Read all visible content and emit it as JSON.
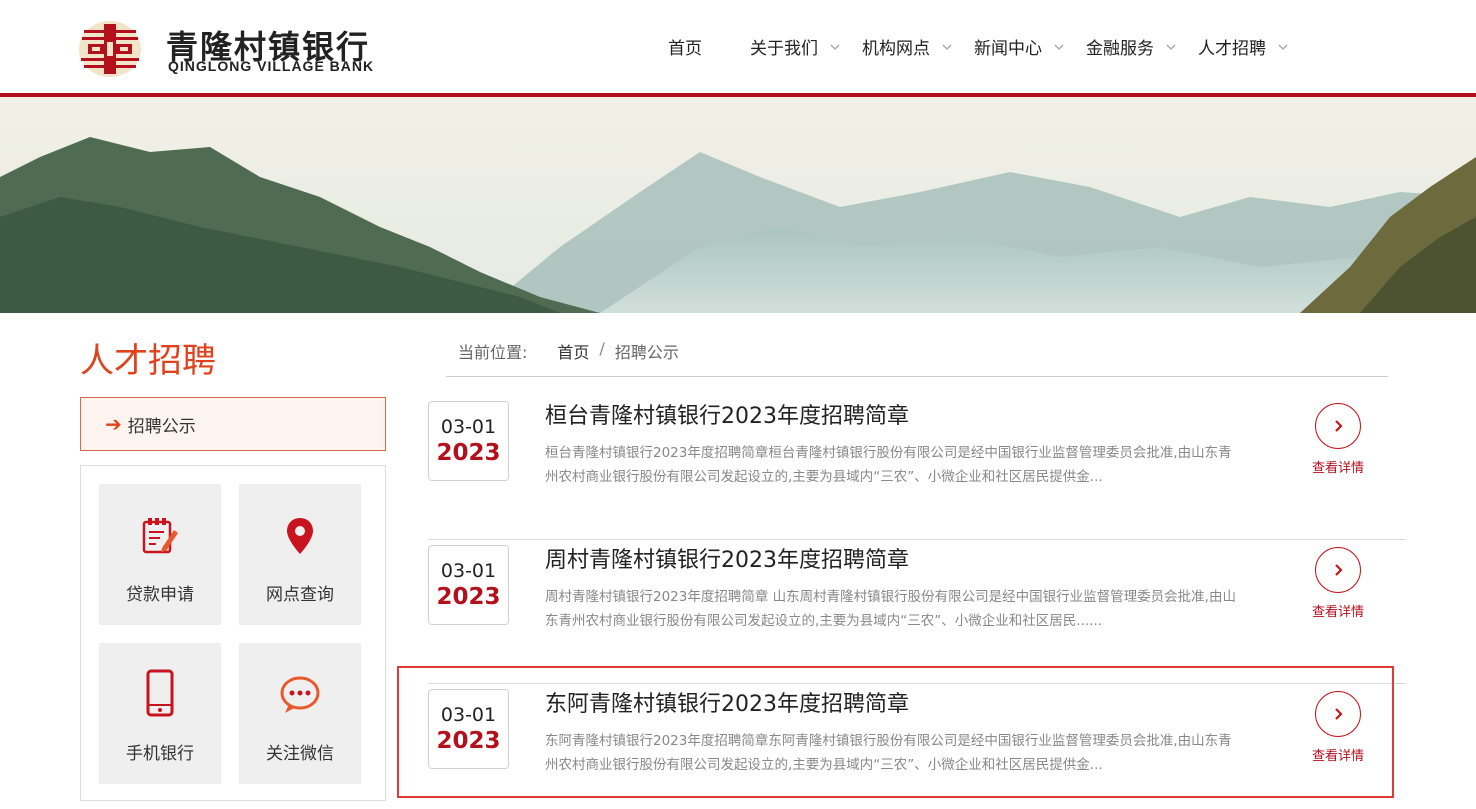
{
  "brand": {
    "name_cn": "青隆村镇银行",
    "name_en": "QINGLONG VILLAGE BANK",
    "accent": "#b4101c",
    "highlight": "#e0431b"
  },
  "nav": {
    "items": [
      {
        "label": "首页",
        "has_dropdown": false
      },
      {
        "label": "关于我们",
        "has_dropdown": true
      },
      {
        "label": "机构网点",
        "has_dropdown": true
      },
      {
        "label": "新闻中心",
        "has_dropdown": true
      },
      {
        "label": "金融服务",
        "has_dropdown": true
      },
      {
        "label": "人才招聘",
        "has_dropdown": true
      }
    ]
  },
  "sidebar": {
    "title": "人才招聘",
    "active_item": "招聘公示",
    "quick_links": [
      {
        "label": "贷款申请",
        "icon": "loan-form-icon"
      },
      {
        "label": "网点查询",
        "icon": "location-pin-icon"
      },
      {
        "label": "手机银行",
        "icon": "mobile-phone-icon"
      },
      {
        "label": "关注微信",
        "icon": "wechat-chat-icon"
      }
    ]
  },
  "breadcrumb": {
    "label": "当前位置:",
    "home": "首页",
    "separator": "/",
    "current": "招聘公示"
  },
  "articles": [
    {
      "date_md": "03-01",
      "year": "2023",
      "title": "桓台青隆村镇银行2023年度招聘简章",
      "summary": "桓台青隆村镇银行2023年度招聘简章桓台青隆村镇银行股份有限公司是经中国银行业监督管理委员会批准,由山东青州农村商业银行股份有限公司发起设立的,主要为县域内“三农”、小微企业和社区居民提供金...",
      "detail_label": "查看详情"
    },
    {
      "date_md": "03-01",
      "year": "2023",
      "title": "周村青隆村镇银行2023年度招聘简章",
      "summary": "周村青隆村镇银行2023年度招聘简章 山东周村青隆村镇银行股份有限公司是经中国银行业监督管理委员会批准,由山东青州农村商业银行股份有限公司发起设立的,主要为县域内“三农”、小微企业和社区居民......",
      "detail_label": "查看详情"
    },
    {
      "date_md": "03-01",
      "year": "2023",
      "title": "东阿青隆村镇银行2023年度招聘简章",
      "summary": "东阿青隆村镇银行2023年度招聘简章东阿青隆村镇银行股份有限公司是经中国银行业监督管理委员会批准,由山东青州农村商业银行股份有限公司发起设立的,主要为县域内“三农”、小微企业和社区居民提供金...",
      "detail_label": "查看详情"
    }
  ]
}
